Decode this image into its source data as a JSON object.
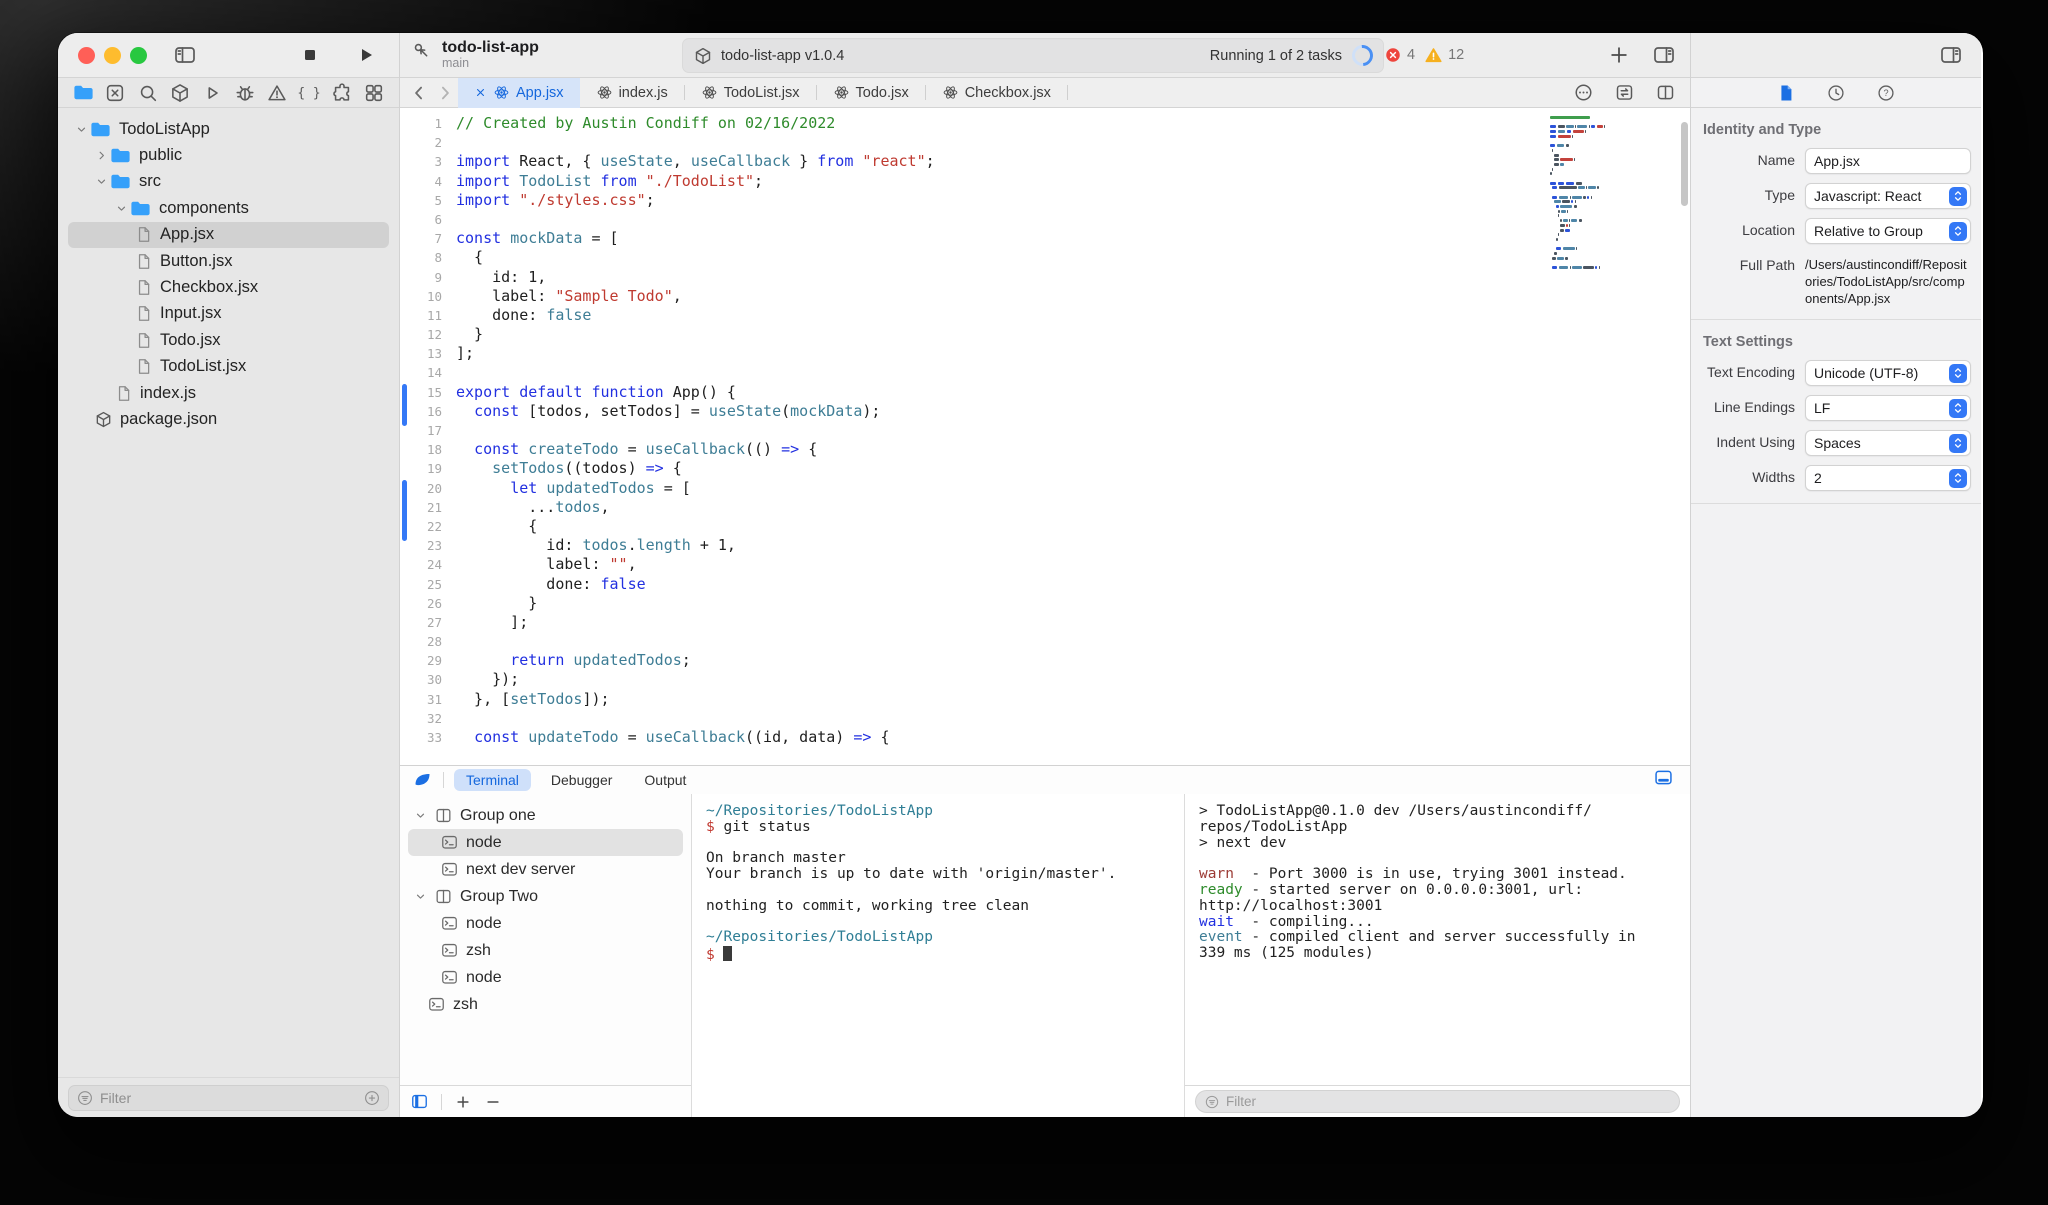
{
  "colors": {
    "accent": "#3478f6",
    "active_tab_bg": "#d6e4f9",
    "active_text": "#1467dd",
    "error_badge": "#ee453d",
    "warning_badge": "#f6b01f",
    "traffic_red": "#ff5f57",
    "traffic_yellow": "#febc2e",
    "traffic_green": "#28c840",
    "code_comment": "#2e8b2b",
    "code_keyword": "#2230e0",
    "code_identifier": "#3e7d95",
    "code_string": "#bf3a30"
  },
  "toolbar": {
    "project_name": "todo-list-app",
    "branch": "main",
    "status_label": "todo-list-app v1.0.4",
    "tasks_label": "Running 1 of 2 tasks",
    "error_count": "4",
    "warning_count": "12"
  },
  "navigator": {
    "icons": [
      "folder-blue",
      "close-box",
      "search",
      "package",
      "play-outline",
      "bug",
      "warning",
      "braces",
      "puzzle",
      "grid"
    ],
    "tree": [
      {
        "label": "TodoListApp",
        "type": "folder",
        "depth": 0,
        "chevron": "down"
      },
      {
        "label": "public",
        "type": "folder",
        "depth": 1,
        "chevron": "right"
      },
      {
        "label": "src",
        "type": "folder",
        "depth": 1,
        "chevron": "down"
      },
      {
        "label": "components",
        "type": "folder",
        "depth": 2,
        "chevron": "down"
      },
      {
        "label": "App.jsx",
        "type": "file",
        "depth": 3,
        "selected": true
      },
      {
        "label": "Button.jsx",
        "type": "file",
        "depth": 3
      },
      {
        "label": "Checkbox.jsx",
        "type": "file",
        "depth": 3
      },
      {
        "label": "Input.jsx",
        "type": "file",
        "depth": 3
      },
      {
        "label": "Todo.jsx",
        "type": "file",
        "depth": 3
      },
      {
        "label": "TodoList.jsx",
        "type": "file",
        "depth": 3
      },
      {
        "label": "index.js",
        "type": "file",
        "depth": 2
      },
      {
        "label": "package.json",
        "type": "package",
        "depth": 1
      }
    ],
    "filter_placeholder": "Filter"
  },
  "editor": {
    "tabs": [
      {
        "label": "App.jsx",
        "active": true
      },
      {
        "label": "index.js",
        "active": false
      },
      {
        "label": "TodoList.jsx",
        "active": false
      },
      {
        "label": "Todo.jsx",
        "active": false
      },
      {
        "label": "Checkbox.jsx",
        "active": false
      }
    ],
    "changed_ranges": [
      [
        15,
        16
      ],
      [
        20,
        22
      ]
    ],
    "code": [
      [
        [
          "// Created by Austin Condiff on 02/16/2022",
          "c"
        ]
      ],
      [],
      [
        [
          "import",
          "k"
        ],
        [
          " React, { ",
          "p"
        ],
        [
          "useState",
          "v"
        ],
        [
          ", ",
          "p"
        ],
        [
          "useCallback",
          "v"
        ],
        [
          " } ",
          "p"
        ],
        [
          "from",
          "k"
        ],
        [
          " ",
          "p"
        ],
        [
          "\"react\"",
          "s"
        ],
        [
          ";",
          "p"
        ]
      ],
      [
        [
          "import",
          "k"
        ],
        [
          " ",
          "p"
        ],
        [
          "TodoList",
          "v"
        ],
        [
          " ",
          "p"
        ],
        [
          "from",
          "k"
        ],
        [
          " ",
          "p"
        ],
        [
          "\"./TodoList\"",
          "s"
        ],
        [
          ";",
          "p"
        ]
      ],
      [
        [
          "import",
          "k"
        ],
        [
          " ",
          "p"
        ],
        [
          "\"./styles.css\"",
          "s"
        ],
        [
          ";",
          "p"
        ]
      ],
      [],
      [
        [
          "const",
          "k"
        ],
        [
          " ",
          "p"
        ],
        [
          "mockData",
          "v"
        ],
        [
          " = [",
          "p"
        ]
      ],
      [
        [
          "  {",
          "p"
        ]
      ],
      [
        [
          "    id: 1,",
          "p"
        ]
      ],
      [
        [
          "    label: ",
          "p"
        ],
        [
          "\"Sample Todo\"",
          "s"
        ],
        [
          ",",
          "p"
        ]
      ],
      [
        [
          "    done: ",
          "p"
        ],
        [
          "false",
          "v"
        ]
      ],
      [
        [
          "  }",
          "p"
        ]
      ],
      [
        [
          "];",
          "p"
        ]
      ],
      [],
      [
        [
          "export",
          "k"
        ],
        [
          " ",
          "p"
        ],
        [
          "default",
          "k"
        ],
        [
          " ",
          "p"
        ],
        [
          "function",
          "k"
        ],
        [
          " App() {",
          "p"
        ]
      ],
      [
        [
          "  ",
          "p"
        ],
        [
          "const",
          "k"
        ],
        [
          " [todos, setTodos] = ",
          "p"
        ],
        [
          "useState",
          "v"
        ],
        [
          "(",
          "p"
        ],
        [
          "mockData",
          "v"
        ],
        [
          ");",
          "p"
        ]
      ],
      [],
      [
        [
          "  ",
          "p"
        ],
        [
          "const",
          "k"
        ],
        [
          " ",
          "p"
        ],
        [
          "createTodo",
          "v"
        ],
        [
          " = ",
          "p"
        ],
        [
          "useCallback",
          "v"
        ],
        [
          "(() ",
          "p"
        ],
        [
          "=>",
          "k"
        ],
        [
          " {",
          "p"
        ]
      ],
      [
        [
          "    ",
          "p"
        ],
        [
          "setTodos",
          "v"
        ],
        [
          "((todos) ",
          "p"
        ],
        [
          "=>",
          "k"
        ],
        [
          " {",
          "p"
        ]
      ],
      [
        [
          "      ",
          "p"
        ],
        [
          "let",
          "k"
        ],
        [
          " ",
          "p"
        ],
        [
          "updatedTodos",
          "v"
        ],
        [
          " = [",
          "p"
        ]
      ],
      [
        [
          "        ...",
          "p"
        ],
        [
          "todos",
          "v"
        ],
        [
          ",",
          "p"
        ]
      ],
      [
        [
          "        {",
          "p"
        ]
      ],
      [
        [
          "          id: ",
          "p"
        ],
        [
          "todos",
          "v"
        ],
        [
          ".",
          "p"
        ],
        [
          "length",
          "v"
        ],
        [
          " + 1,",
          "p"
        ]
      ],
      [
        [
          "          label: ",
          "p"
        ],
        [
          "\"\"",
          "s"
        ],
        [
          ",",
          "p"
        ]
      ],
      [
        [
          "          done: ",
          "p"
        ],
        [
          "false",
          "k"
        ]
      ],
      [
        [
          "        }",
          "p"
        ]
      ],
      [
        [
          "      ];",
          "p"
        ]
      ],
      [],
      [
        [
          "      ",
          "p"
        ],
        [
          "return",
          "k"
        ],
        [
          " ",
          "p"
        ],
        [
          "updatedTodos",
          "v"
        ],
        [
          ";",
          "p"
        ]
      ],
      [
        [
          "    });",
          "p"
        ]
      ],
      [
        [
          "  }, [",
          "p"
        ],
        [
          "setTodos",
          "v"
        ],
        [
          "]);",
          "p"
        ]
      ],
      [],
      [
        [
          "  ",
          "p"
        ],
        [
          "const",
          "k"
        ],
        [
          " ",
          "p"
        ],
        [
          "updateTodo",
          "v"
        ],
        [
          " = ",
          "p"
        ],
        [
          "useCallback",
          "v"
        ],
        [
          "((id, data) ",
          "p"
        ],
        [
          "=>",
          "k"
        ],
        [
          " {",
          "p"
        ]
      ]
    ]
  },
  "utility": {
    "tabs": [
      {
        "label": "Terminal",
        "active": true
      },
      {
        "label": "Debugger",
        "active": false
      },
      {
        "label": "Output",
        "active": false
      }
    ],
    "sessions": [
      {
        "label": "Group one",
        "type": "group",
        "indent": 0
      },
      {
        "label": "node",
        "type": "terminal",
        "indent": 1,
        "selected": true
      },
      {
        "label": "next dev server",
        "type": "terminal",
        "indent": 1
      },
      {
        "label": "Group Two",
        "type": "group",
        "indent": 0
      },
      {
        "label": "node",
        "type": "terminal",
        "indent": 1
      },
      {
        "label": "zsh",
        "type": "terminal",
        "indent": 1
      },
      {
        "label": "node",
        "type": "terminal",
        "indent": 1
      },
      {
        "label": "zsh",
        "type": "terminal",
        "indent": 0.5
      }
    ],
    "terminal1": [
      [
        [
          "~/Repositories/TodoListApp",
          "path"
        ]
      ],
      [
        [
          "$",
          "dollar"
        ],
        [
          " git status",
          "t"
        ]
      ],
      [],
      [
        [
          "On branch master",
          "t"
        ]
      ],
      [
        [
          "Your branch is up to date with 'origin/master'.",
          "t"
        ]
      ],
      [],
      [
        [
          "nothing to commit, working tree clean",
          "t"
        ]
      ],
      [],
      [
        [
          "~/Repositories/TodoListApp",
          "path"
        ]
      ],
      [
        [
          "$ ",
          "dollar"
        ],
        [
          "",
          "cur"
        ]
      ]
    ],
    "terminal2": [
      [
        [
          "> TodoListApp@0.1.0 dev /Users/austincondiff/",
          "t"
        ]
      ],
      [
        [
          "repos/TodoListApp",
          "t"
        ]
      ],
      [
        [
          "> next dev",
          "t"
        ]
      ],
      [],
      [
        [
          "warn",
          "warn"
        ],
        [
          "  - Port 3000 is in use, trying 3001 instead.",
          "t"
        ]
      ],
      [
        [
          "ready",
          "ready"
        ],
        [
          " - started server on 0.0.0.0:3001, url:",
          "t"
        ]
      ],
      [
        [
          "http://localhost:3001",
          "t"
        ]
      ],
      [
        [
          "wait",
          "wait"
        ],
        [
          "  - compiling...",
          "t"
        ]
      ],
      [
        [
          "event",
          "event"
        ],
        [
          " - compiled client and server successfully in",
          "t"
        ]
      ],
      [
        [
          "339 ms (125 modules)",
          "t"
        ]
      ]
    ],
    "filter_placeholder": "Filter"
  },
  "inspector": {
    "identity": {
      "title": "Identity and Type",
      "rows": [
        {
          "label": "Name",
          "value": "App.jsx",
          "control": "input"
        },
        {
          "label": "Type",
          "value": "Javascript: React",
          "control": "select"
        },
        {
          "label": "Location",
          "value": "Relative to Group",
          "control": "select"
        },
        {
          "label": "Full Path",
          "value": "/Users/austincondiff/Repositories/TodoListApp/src/components/App.jsx",
          "control": "text"
        }
      ]
    },
    "text_settings": {
      "title": "Text Settings",
      "rows": [
        {
          "label": "Text Encoding",
          "value": "Unicode (UTF-8)",
          "control": "select"
        },
        {
          "label": "Line Endings",
          "value": "LF",
          "control": "select"
        },
        {
          "label": "Indent Using",
          "value": "Spaces",
          "control": "select"
        },
        {
          "label": "Widths",
          "value": "2",
          "control": "select"
        }
      ]
    }
  }
}
